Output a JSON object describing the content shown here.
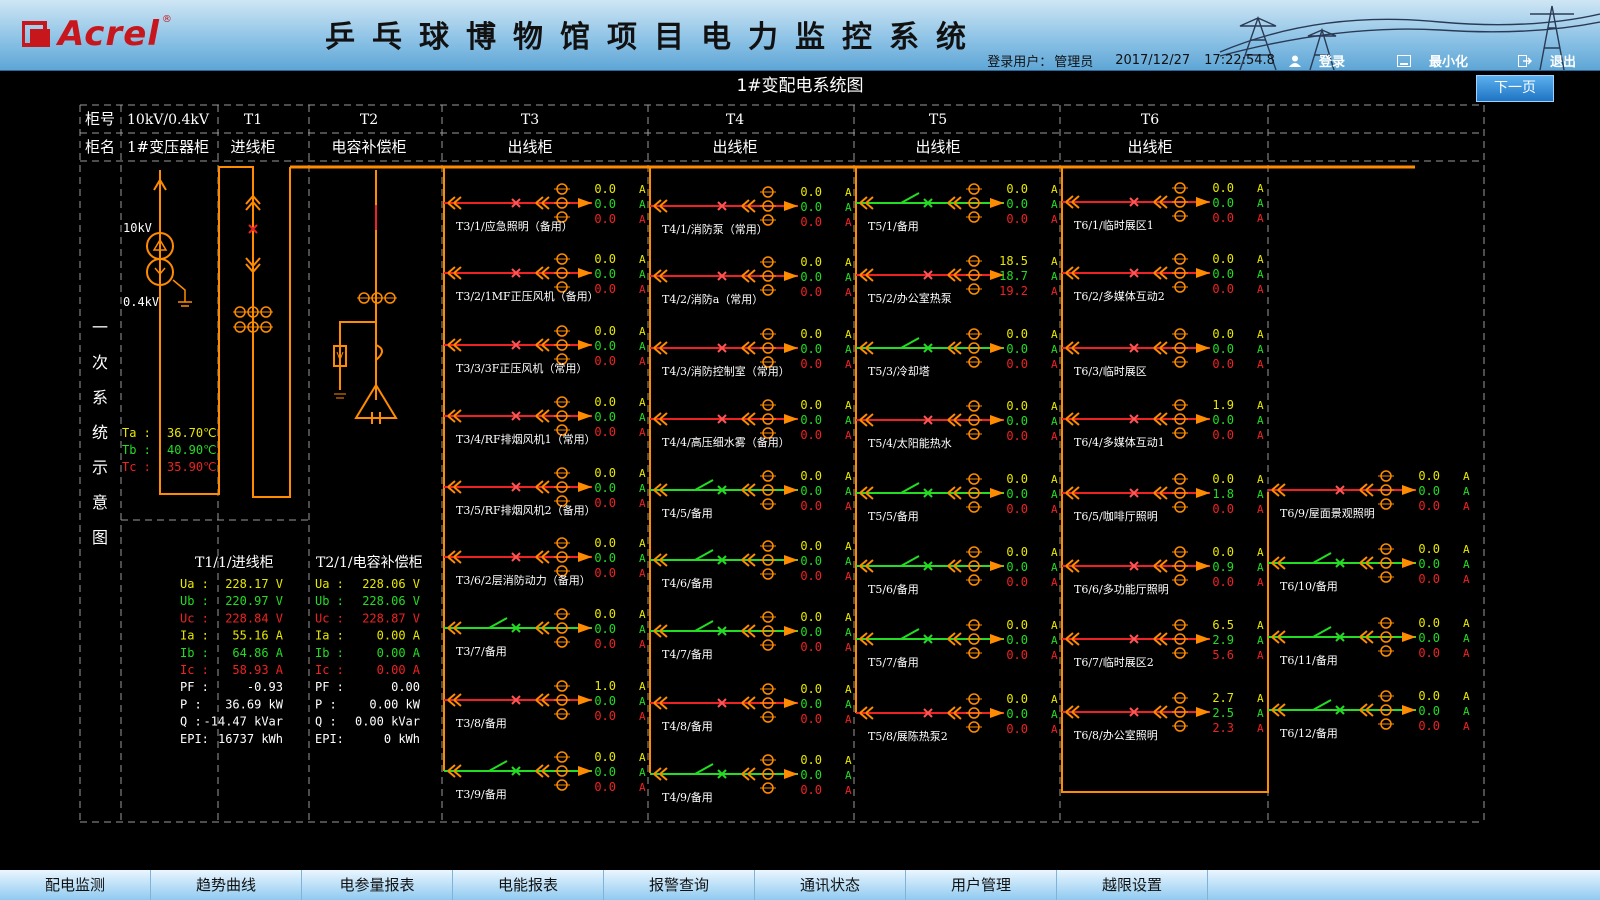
{
  "header": {
    "logo_text": "Acrel",
    "logo_reg": "®",
    "title": "乒乓球博物馆项目电力监控系统",
    "login_label": "登录用户：",
    "user": "管理员",
    "date": "2017/12/27",
    "time": "17:22:54.8",
    "login_btn": "登录",
    "minimize_btn": "最小化",
    "exit_btn": "退出"
  },
  "page_title": "1#变配电系统图",
  "next_btn": "下一页",
  "cabinets": {
    "no_label": "柜号",
    "name_label": "柜名",
    "cols": [
      {
        "no": "10kV/0.4kV",
        "name": "1#变压器柜"
      },
      {
        "no": "T1",
        "name": "进线柜"
      },
      {
        "no": "T2",
        "name": "电容补偿柜"
      },
      {
        "no": "T3",
        "name": "出线柜"
      },
      {
        "no": "T4",
        "name": "出线柜"
      },
      {
        "no": "T5",
        "name": "出线柜"
      },
      {
        "no": "T6",
        "name": "出线柜"
      }
    ]
  },
  "side_label": [
    "一",
    "次",
    "系",
    "统",
    "示",
    "意",
    "图"
  ],
  "transformer": {
    "hv": "10kV",
    "lv": "0.4kV",
    "temps": [
      {
        "k": "Ta :",
        "v": "36.70℃",
        "c": "#e8e800"
      },
      {
        "k": "Tb :",
        "v": "40.90℃",
        "c": "#22dd22"
      },
      {
        "k": "Tc :",
        "v": "35.90℃",
        "c": "#ee2222"
      }
    ]
  },
  "meters": [
    {
      "title": "T1/1/进线柜",
      "rows": [
        [
          "Ua :",
          "228.17 V",
          "#e8e800"
        ],
        [
          "Ub :",
          "220.97 V",
          "#22dd22"
        ],
        [
          "Uc :",
          "228.84 V",
          "#ee2222"
        ],
        [
          "Ia :",
          "55.16 A",
          "#e8e800"
        ],
        [
          "Ib :",
          "64.86 A",
          "#22dd22"
        ],
        [
          "Ic :",
          "58.93 A",
          "#ee2222"
        ],
        [
          "PF :",
          "-0.93",
          "#ffffff"
        ],
        [
          "P  :",
          "36.69 kW",
          "#ffffff"
        ],
        [
          "Q  :",
          "-14.47 kVar",
          "#ffffff"
        ],
        [
          "EPI:",
          "16737 kWh",
          "#ffffff"
        ]
      ]
    },
    {
      "title": "T2/1/电容补偿柜",
      "rows": [
        [
          "Ua :",
          "228.06 V",
          "#e8e800"
        ],
        [
          "Ub :",
          "228.06 V",
          "#22dd22"
        ],
        [
          "Uc :",
          "228.87 V",
          "#ee2222"
        ],
        [
          "Ia :",
          "0.00 A",
          "#e8e800"
        ],
        [
          "Ib :",
          "0.00 A",
          "#22dd22"
        ],
        [
          "Ic :",
          "0.00 A",
          "#ee2222"
        ],
        [
          "PF :",
          "0.00",
          "#ffffff"
        ],
        [
          "P  :",
          "0.00 kW",
          "#ffffff"
        ],
        [
          "Q  :",
          "0.00 kVar",
          "#ffffff"
        ],
        [
          "EPI:",
          "0 kWh",
          "#ffffff"
        ]
      ]
    }
  ],
  "colors": {
    "bus": "#ff8c00",
    "red": "#ee2222",
    "green": "#22dd22",
    "yellow": "#e8e800",
    "grid": "#9a9a9a"
  },
  "feeders": {
    "T3": [
      {
        "label": "T3/1/应急照明（备用）",
        "state": "closed",
        "v": [
          "0.0",
          "0.0",
          "0.0"
        ]
      },
      {
        "label": "T3/2/1MF正压风机（备用）",
        "state": "closed",
        "v": [
          "0.0",
          "0.0",
          "0.0"
        ]
      },
      {
        "label": "T3/3/3F正压风机（常用）",
        "state": "closed",
        "v": [
          "0.0",
          "0.0",
          "0.0"
        ]
      },
      {
        "label": "T3/4/RF排烟风机1（常用）",
        "state": "closed",
        "v": [
          "0.0",
          "0.0",
          "0.0"
        ]
      },
      {
        "label": "T3/5/RF排烟风机2（备用）",
        "state": "closed",
        "v": [
          "0.0",
          "0.0",
          "0.0"
        ]
      },
      {
        "label": "T3/6/2层消防动力（备用）",
        "state": "closed",
        "v": [
          "0.0",
          "0.0",
          "0.0"
        ]
      },
      {
        "label": "T3/7/备用",
        "state": "open",
        "v": [
          "0.0",
          "0.0",
          "0.0"
        ]
      },
      {
        "label": "T3/8/备用",
        "state": "closed",
        "v": [
          "1.0",
          "0.0",
          "0.0"
        ]
      },
      {
        "label": "T3/9/备用",
        "state": "open",
        "v": [
          "0.0",
          "0.0",
          "0.0"
        ]
      }
    ],
    "T4": [
      {
        "label": "T4/1/消防泵（常用）",
        "state": "closed",
        "v": [
          "0.0",
          "0.0",
          "0.0"
        ]
      },
      {
        "label": "T4/2/消防a（常用）",
        "state": "closed",
        "v": [
          "0.0",
          "0.0",
          "0.0"
        ]
      },
      {
        "label": "T4/3/消防控制室（常用）",
        "state": "closed",
        "v": [
          "0.0",
          "0.0",
          "0.0"
        ]
      },
      {
        "label": "T4/4/高压细水雾（备用）",
        "state": "closed",
        "v": [
          "0.0",
          "0.0",
          "0.0"
        ]
      },
      {
        "label": "T4/5/备用",
        "state": "open",
        "v": [
          "0.0",
          "0.0",
          "0.0"
        ]
      },
      {
        "label": "T4/6/备用",
        "state": "open",
        "v": [
          "0.0",
          "0.0",
          "0.0"
        ]
      },
      {
        "label": "T4/7/备用",
        "state": "open",
        "v": [
          "0.0",
          "0.0",
          "0.0"
        ]
      },
      {
        "label": "T4/8/备用",
        "state": "closed",
        "v": [
          "0.0",
          "0.0",
          "0.0"
        ]
      },
      {
        "label": "T4/9/备用",
        "state": "open",
        "v": [
          "0.0",
          "0.0",
          "0.0"
        ]
      }
    ],
    "T5": [
      {
        "label": "T5/1/备用",
        "state": "open",
        "v": [
          "0.0",
          "0.0",
          "0.0"
        ]
      },
      {
        "label": "T5/2/办公室热泵",
        "state": "closed",
        "v": [
          "18.5",
          "18.7",
          "19.2"
        ]
      },
      {
        "label": "T5/3/冷却塔",
        "state": "open",
        "v": [
          "0.0",
          "0.0",
          "0.0"
        ]
      },
      {
        "label": "T5/4/太阳能热水",
        "state": "closed",
        "v": [
          "0.0",
          "0.0",
          "0.0"
        ]
      },
      {
        "label": "T5/5/备用",
        "state": "open",
        "v": [
          "0.0",
          "0.0",
          "0.0"
        ]
      },
      {
        "label": "T5/6/备用",
        "state": "open",
        "v": [
          "0.0",
          "0.0",
          "0.0"
        ]
      },
      {
        "label": "T5/7/备用",
        "state": "open",
        "v": [
          "0.0",
          "0.0",
          "0.0"
        ]
      },
      {
        "label": "T5/8/展陈热泵2",
        "state": "closed",
        "v": [
          "0.0",
          "0.0",
          "0.0"
        ]
      }
    ],
    "T6": [
      {
        "label": "T6/1/临时展区1",
        "state": "closed",
        "v": [
          "0.0",
          "0.0",
          "0.0"
        ]
      },
      {
        "label": "T6/2/多媒体互动2",
        "state": "closed",
        "v": [
          "0.0",
          "0.0",
          "0.0"
        ]
      },
      {
        "label": "T6/3/临时展区",
        "state": "closed",
        "v": [
          "0.0",
          "0.0",
          "0.0"
        ]
      },
      {
        "label": "T6/4/多媒体互动1",
        "state": "closed",
        "v": [
          "1.9",
          "0.0",
          "0.0"
        ]
      },
      {
        "label": "T6/5/咖啡厅照明",
        "state": "closed",
        "v": [
          "0.0",
          "1.8",
          "0.0"
        ]
      },
      {
        "label": "T6/6/多功能厅照明",
        "state": "closed",
        "v": [
          "0.0",
          "0.9",
          "0.0"
        ]
      },
      {
        "label": "T6/7/临时展区2",
        "state": "closed",
        "v": [
          "6.5",
          "2.9",
          "5.6"
        ]
      },
      {
        "label": "T6/8/办公室照明",
        "state": "closed",
        "v": [
          "2.7",
          "2.5",
          "2.3"
        ]
      },
      {
        "label": "T6/9/屋面景观照明",
        "state": "closed",
        "v": [
          "0.0",
          "0.0",
          "0.0"
        ]
      },
      {
        "label": "T6/10/备用",
        "state": "open",
        "v": [
          "0.0",
          "0.0",
          "0.0"
        ]
      },
      {
        "label": "T6/11/备用",
        "state": "open",
        "v": [
          "0.0",
          "0.0",
          "0.0"
        ]
      },
      {
        "label": "T6/12/备用",
        "state": "open",
        "v": [
          "0.0",
          "0.0",
          "0.0"
        ]
      }
    ],
    "unit": "A"
  },
  "tabs": [
    "配电监测",
    "趋势曲线",
    "电参量报表",
    "电能报表",
    "报警查询",
    "通讯状态",
    "用户管理",
    "越限设置",
    ""
  ]
}
